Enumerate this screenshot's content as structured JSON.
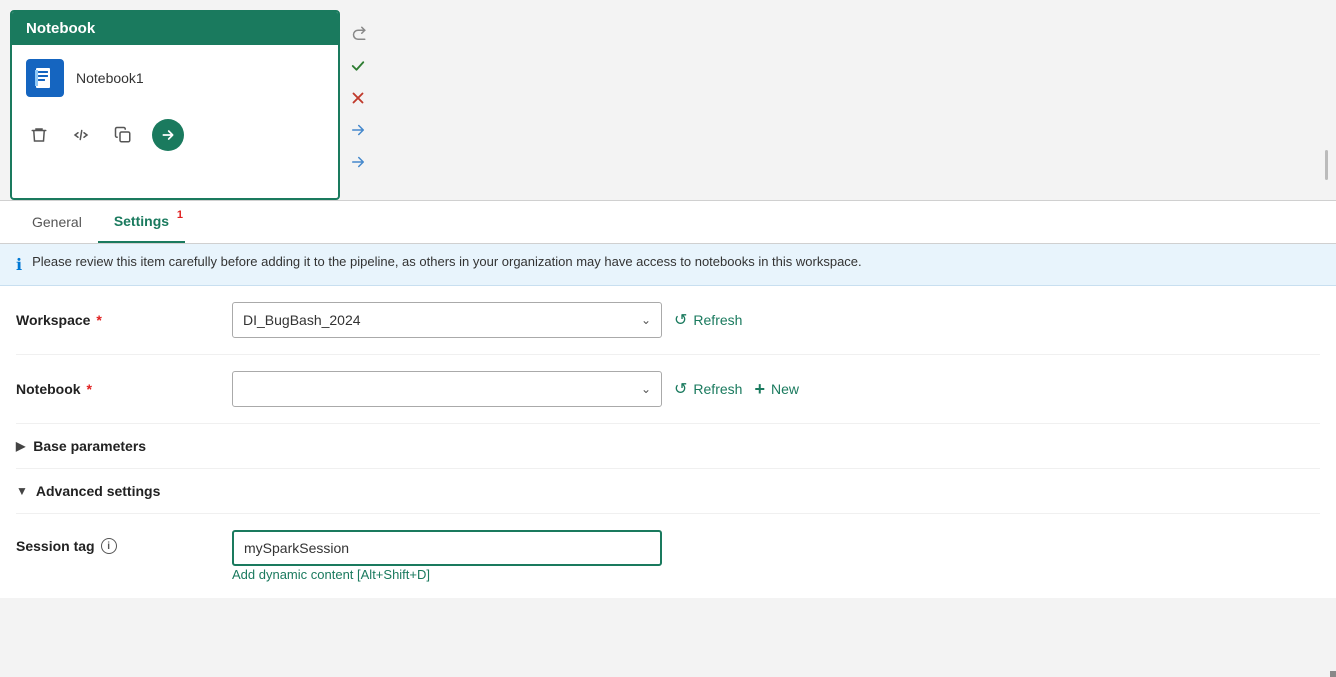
{
  "notebook_card": {
    "title": "Notebook",
    "item_name": "Notebook1",
    "actions": {
      "delete_label": "delete",
      "code_label": "code",
      "copy_label": "copy",
      "go_label": "go"
    }
  },
  "side_controls": {
    "redo_label": "redo",
    "check_label": "check",
    "close_label": "close",
    "arrow_right_label": "arrow-right",
    "arrow_right2_label": "arrow-right-2"
  },
  "tabs": [
    {
      "id": "general",
      "label": "General",
      "active": false,
      "badge": null
    },
    {
      "id": "settings",
      "label": "Settings",
      "active": true,
      "badge": "1"
    }
  ],
  "info_banner": {
    "message": "Please review this item carefully before adding it to the pipeline, as others in your organization may have access to notebooks in this workspace."
  },
  "workspace_field": {
    "label": "Workspace",
    "required": true,
    "value": "DI_BugBash_2024",
    "placeholder": "",
    "refresh_label": "Refresh"
  },
  "notebook_field": {
    "label": "Notebook",
    "required": true,
    "value": "",
    "placeholder": "",
    "refresh_label": "Refresh",
    "new_label": "New"
  },
  "base_parameters": {
    "label": "Base parameters",
    "expanded": false
  },
  "advanced_settings": {
    "label": "Advanced settings",
    "expanded": true
  },
  "session_tag": {
    "label": "Session tag",
    "value": "mySparkSession",
    "dynamic_content_link": "Add dynamic content [Alt+Shift+D]"
  },
  "colors": {
    "teal": "#1a7a5e",
    "red": "#e02020",
    "blue_info": "#0078d4"
  }
}
